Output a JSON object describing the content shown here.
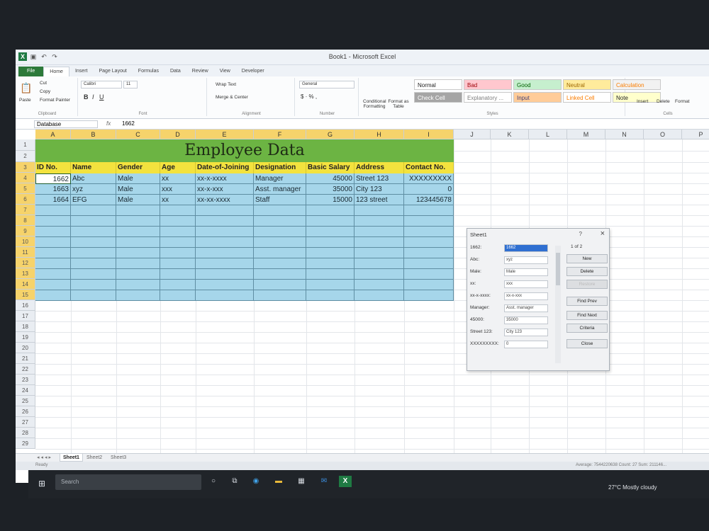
{
  "window": {
    "title": "Book1 - Microsoft Excel"
  },
  "ribbon": {
    "tabs": [
      "File",
      "Home",
      "Insert",
      "Page Layout",
      "Formulas",
      "Data",
      "Review",
      "View",
      "Developer"
    ],
    "clipboard": {
      "paste": "Paste",
      "cut": "Cut",
      "copy": "Copy",
      "format_painter": "Format Painter",
      "label": "Clipboard"
    },
    "font": {
      "name": "Calibri",
      "size": "11",
      "label": "Font"
    },
    "alignment": {
      "wrap": "Wrap Text",
      "merge": "Merge & Center",
      "label": "Alignment"
    },
    "number": {
      "format": "General",
      "label": "Number"
    },
    "styles": {
      "conditional": "Conditional Formatting",
      "format_table": "Format as Table",
      "label": "Styles",
      "cells": [
        {
          "name": "Normal",
          "bg": "#ffffff",
          "fg": "#222222"
        },
        {
          "name": "Bad",
          "bg": "#ffc7ce",
          "fg": "#9c0006"
        },
        {
          "name": "Good",
          "bg": "#c6efce",
          "fg": "#006100"
        },
        {
          "name": "Neutral",
          "bg": "#ffeb9c",
          "fg": "#9c6500"
        },
        {
          "name": "Calculation",
          "bg": "#f2f2f2",
          "fg": "#fa7d00"
        },
        {
          "name": "Check Cell",
          "bg": "#a5a5a5",
          "fg": "#ffffff"
        },
        {
          "name": "Explanatory ...",
          "bg": "#ffffff",
          "fg": "#7f7f7f"
        },
        {
          "name": "Input",
          "bg": "#ffcc99",
          "fg": "#3f3f76"
        },
        {
          "name": "Linked Cell",
          "bg": "#ffffff",
          "fg": "#fa7d00"
        },
        {
          "name": "Note",
          "bg": "#ffffcc",
          "fg": "#222222"
        }
      ]
    },
    "cells": {
      "insert": "Insert",
      "delete": "Delete",
      "format": "Format",
      "label": "Cells"
    }
  },
  "formula_bar": {
    "name_box": "Database",
    "fx": "fx",
    "value": "1662"
  },
  "columns": [
    "A",
    "B",
    "C",
    "D",
    "E",
    "F",
    "G",
    "H",
    "I",
    "J",
    "K",
    "L",
    "M",
    "N",
    "O",
    "P"
  ],
  "rows": [
    "1",
    "2",
    "3",
    "4",
    "5",
    "6",
    "7",
    "8",
    "9",
    "10",
    "11",
    "12",
    "13",
    "14",
    "15",
    "16",
    "17",
    "18",
    "19",
    "20",
    "21",
    "22",
    "23",
    "24",
    "25",
    "26",
    "27",
    "28",
    "29"
  ],
  "sheet": {
    "title": "Employee Data",
    "headers": [
      "ID No.",
      "Name",
      "Gender",
      "Age",
      "Date-of-Joining",
      "Designation",
      "Basic Salary",
      "Address",
      "Contact No."
    ],
    "records": [
      [
        "1662",
        "Abc",
        "Male",
        "xx",
        "xx-x-xxxx",
        "Manager",
        "45000",
        "Street 123",
        "XXXXXXXXX"
      ],
      [
        "1663",
        "xyz",
        "Male",
        "xxx",
        "xx-x-xxx",
        "Asst. manager",
        "35000",
        "City 123",
        "0"
      ],
      [
        "1664",
        "EFG",
        "Male",
        "xx",
        "xx-xx-xxxx",
        "Staff",
        "15000",
        "123 street",
        "123445678"
      ]
    ]
  },
  "sheet_tabs": [
    "Sheet1",
    "Sheet2",
    "Sheet3"
  ],
  "status": {
    "ready": "Ready",
    "summary": "Average: 7544220638  Count: 27  Sum: 211146..."
  },
  "dialog": {
    "title": "Sheet1",
    "help": "?",
    "close": "×",
    "counter": "1 of 2",
    "fields": [
      {
        "label": "1662:",
        "value": "1662"
      },
      {
        "label": "Abc:",
        "value": "xyz"
      },
      {
        "label": "Male:",
        "value": "Male"
      },
      {
        "label": "xx:",
        "value": "xxx"
      },
      {
        "label": "xx-x-xxxx:",
        "value": "xx-x-xxx"
      },
      {
        "label": "Manager:",
        "value": "Asst. manager"
      },
      {
        "label": "45000:",
        "value": "35000"
      },
      {
        "label": "Street 123:",
        "value": "City 123"
      },
      {
        "label": "XXXXXXXXX:",
        "value": "0"
      }
    ],
    "buttons": [
      "New",
      "Delete",
      "Restore",
      "Find Prev",
      "Find Next",
      "Criteria",
      "Close"
    ]
  },
  "taskbar": {
    "search": "Search",
    "weather": "27°C  Mostly cloudy"
  }
}
